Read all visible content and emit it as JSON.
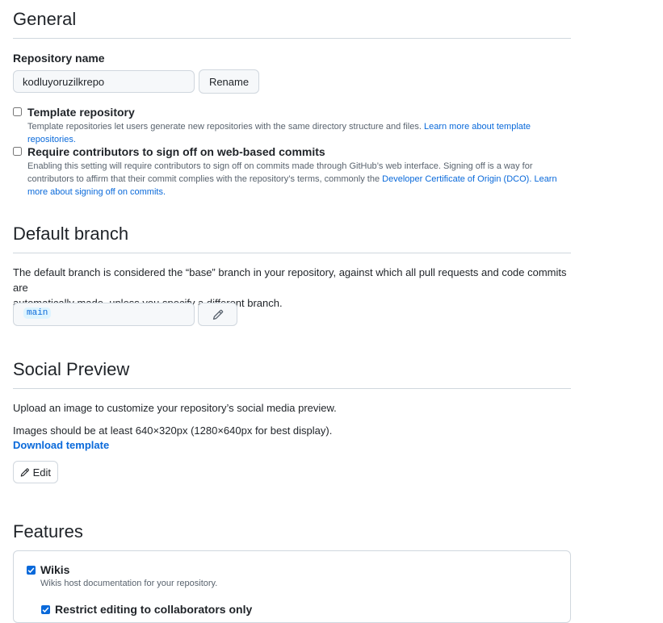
{
  "general": {
    "title": "General",
    "repo_name_label": "Repository name",
    "repo_name_value": "kodluyoruzilkrepo",
    "rename_button": "Rename",
    "template": {
      "label": "Template repository",
      "note": "Template repositories let users generate new repositories with the same directory structure and files.",
      "link": "Learn more about template repositories."
    },
    "signoff": {
      "label": "Require contributors to sign off on web-based commits",
      "note_line1": "Enabling this setting will require contributors to sign off on commits made through GitHub’s web interface. Signing off is a way for",
      "note_line2_pre": "contributors to affirm that their commit complies with the repository’s terms, commonly the",
      "note_link1": "Developer Certificate of Origin (DCO).",
      "note_link2_part1": "Learn",
      "note_link2_part2": "more about signing off on commits."
    }
  },
  "default_branch": {
    "title": "Default branch",
    "description_line1": "The default branch is considered the “base” branch in your repository, against which all pull requests and code commits are",
    "description_line2": "automatically made, unless you specify a different branch.",
    "branch": "main"
  },
  "social_preview": {
    "title": "Social Preview",
    "description": "Upload an image to customize your repository’s social media preview.",
    "size_note": "Images should be at least 640×320px (1280×640px for best display).",
    "download_link": "Download template",
    "edit_button": "Edit"
  },
  "features": {
    "title": "Features",
    "wikis_label": "Wikis",
    "wikis_note": "Wikis host documentation for your repository.",
    "restrict_label": "Restrict editing to collaborators only"
  },
  "colors": {
    "link": "#0969da",
    "border": "#d0d7de",
    "muted_text": "#59636e",
    "input_bg": "#f6f8fa"
  }
}
